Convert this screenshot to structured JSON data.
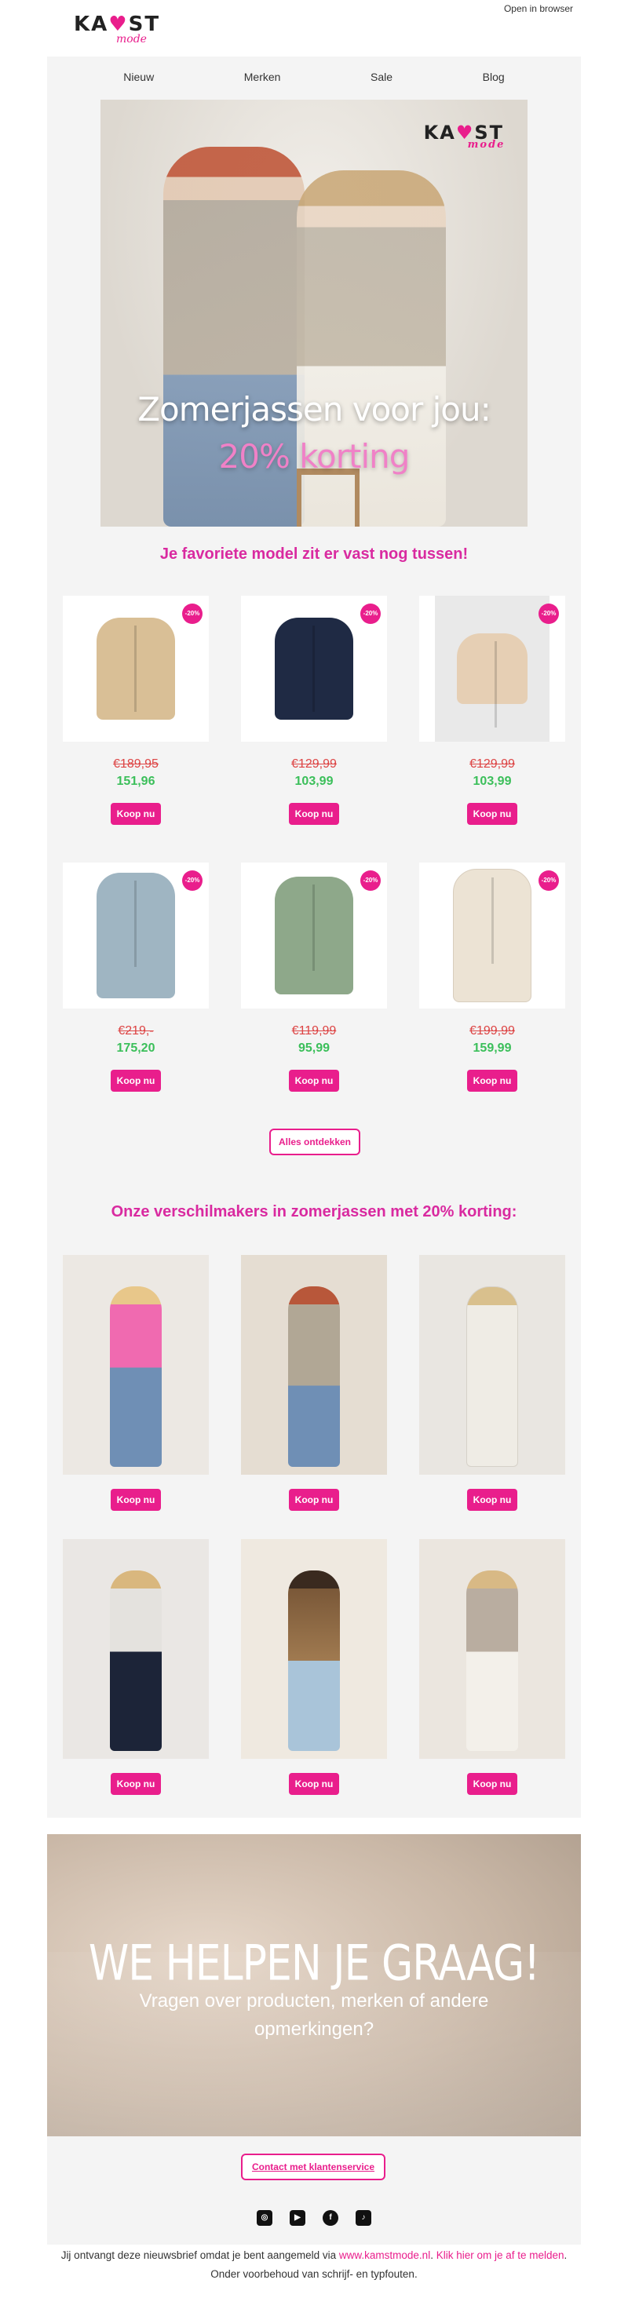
{
  "header": {
    "logo_text": "KAMST",
    "logo_script": "mode",
    "open_in_browser": "Open in browser"
  },
  "nav": [
    "Nieuw",
    "Merken",
    "Sale",
    "Blog"
  ],
  "hero": {
    "logo_text": "KAMST",
    "logo_script": "mode",
    "title": "Zomerjassen voor jou:",
    "subtitle": "20% korting"
  },
  "tagline": "Je favoriete model zit er vast nog tussen!",
  "products": [
    {
      "badge": "-20%",
      "old": "€189,95",
      "new": "151,96",
      "cta": "Koop nu",
      "color": "#d9bf96"
    },
    {
      "badge": "-20%",
      "old": "€129,99",
      "new": "103,99",
      "cta": "Koop nu",
      "color": "#1f2a44"
    },
    {
      "badge": "-20%",
      "old": "€129,99",
      "new": "103,99",
      "cta": "Koop nu",
      "color": "#e6cfb4"
    },
    {
      "badge": "-20%",
      "old": "€219,-",
      "new": "175,20",
      "cta": "Koop nu",
      "color": "#9fb5c2"
    },
    {
      "badge": "-20%",
      "old": "€119,99",
      "new": "95,99",
      "cta": "Koop nu",
      "color": "#8ea88a"
    },
    {
      "badge": "-20%",
      "old": "€199,99",
      "new": "159,99",
      "cta": "Koop nu",
      "color": "#ece3d4"
    }
  ],
  "discover": "Alles ontdekken",
  "section2": {
    "title": "Onze verschilmakers in zomerjassen met 20% korting:",
    "cta": "Koop nu"
  },
  "looks": [
    {
      "bg": "#ece8e3",
      "fig": "#f06ab0"
    },
    {
      "bg": "#e5ddd2",
      "fig": "#b1a795"
    },
    {
      "bg": "#e9e6e1",
      "fig": "#efece5"
    },
    {
      "bg": "#eae7e4",
      "fig": "#1c2438"
    },
    {
      "bg": "#efe9e0",
      "fig": "#7a5838"
    },
    {
      "bg": "#ebe6df",
      "fig": "#d8d0c4"
    }
  ],
  "cta_section": {
    "title": "WE HELPEN JE GRAAG!",
    "text": "Vragen over producten, merken of andere opmerkingen?",
    "button": "Contact met klantenservice"
  },
  "socials": [
    "instagram-icon",
    "youtube-icon",
    "facebook-icon",
    "tiktok-icon"
  ],
  "footer": {
    "text1": "Jij ontvangt deze nieuwsbrief omdat je bent aangemeld via ",
    "link1": "www.kamstmode.nl",
    "text2": ". ",
    "link2": "Klik hier om je af te melden",
    "text3": ". Onder voorbehoud van schrijf- en typfouten."
  }
}
